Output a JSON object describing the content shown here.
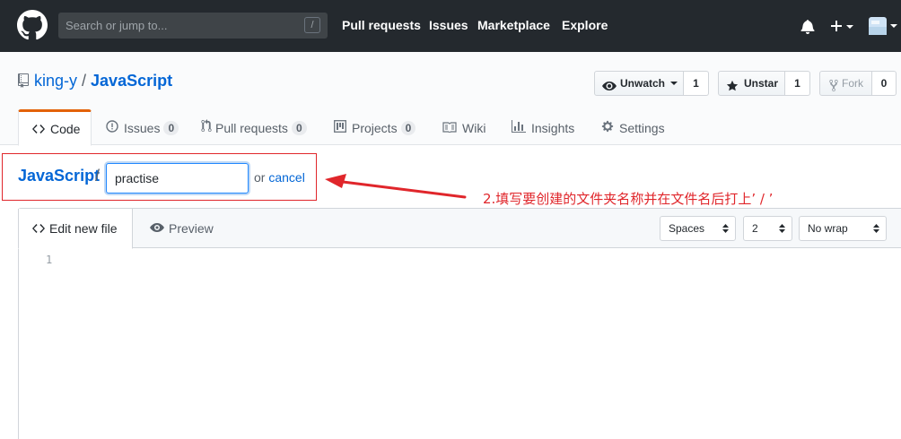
{
  "header": {
    "search_placeholder": "Search or jump to...",
    "search_key": "/",
    "nav": [
      "Pull requests",
      "Issues",
      "Marketplace",
      "Explore"
    ]
  },
  "repo": {
    "owner": "king-y",
    "separator": "/",
    "name": "JavaScript",
    "watch": {
      "label": "Unwatch",
      "count": "1"
    },
    "star": {
      "label": "Unstar",
      "count": "1"
    },
    "fork": {
      "label": "Fork",
      "count": "0"
    }
  },
  "tabs": {
    "code": "Code",
    "issues": {
      "label": "Issues",
      "count": "0"
    },
    "pulls": {
      "label": "Pull requests",
      "count": "0"
    },
    "projects": {
      "label": "Projects",
      "count": "0"
    },
    "wiki": "Wiki",
    "insights": "Insights",
    "settings": "Settings"
  },
  "breadcrumb": {
    "repo": "JavaScript",
    "separator": "/",
    "filename_value": "practise",
    "or": "or",
    "cancel": "cancel"
  },
  "annotation": {
    "text": "2.填写要创建的文件夹名称并在文件名后打上’ / ’",
    "color": "#e0262b"
  },
  "editor": {
    "edit_tab": "Edit new file",
    "preview_tab": "Preview",
    "indent_mode": "Spaces",
    "indent_size": "2",
    "wrap_mode": "No wrap",
    "line_number": "1"
  },
  "colors": {
    "header_bg": "#24292e",
    "link": "#0366d6",
    "selected_tab_accent": "#e36209"
  }
}
